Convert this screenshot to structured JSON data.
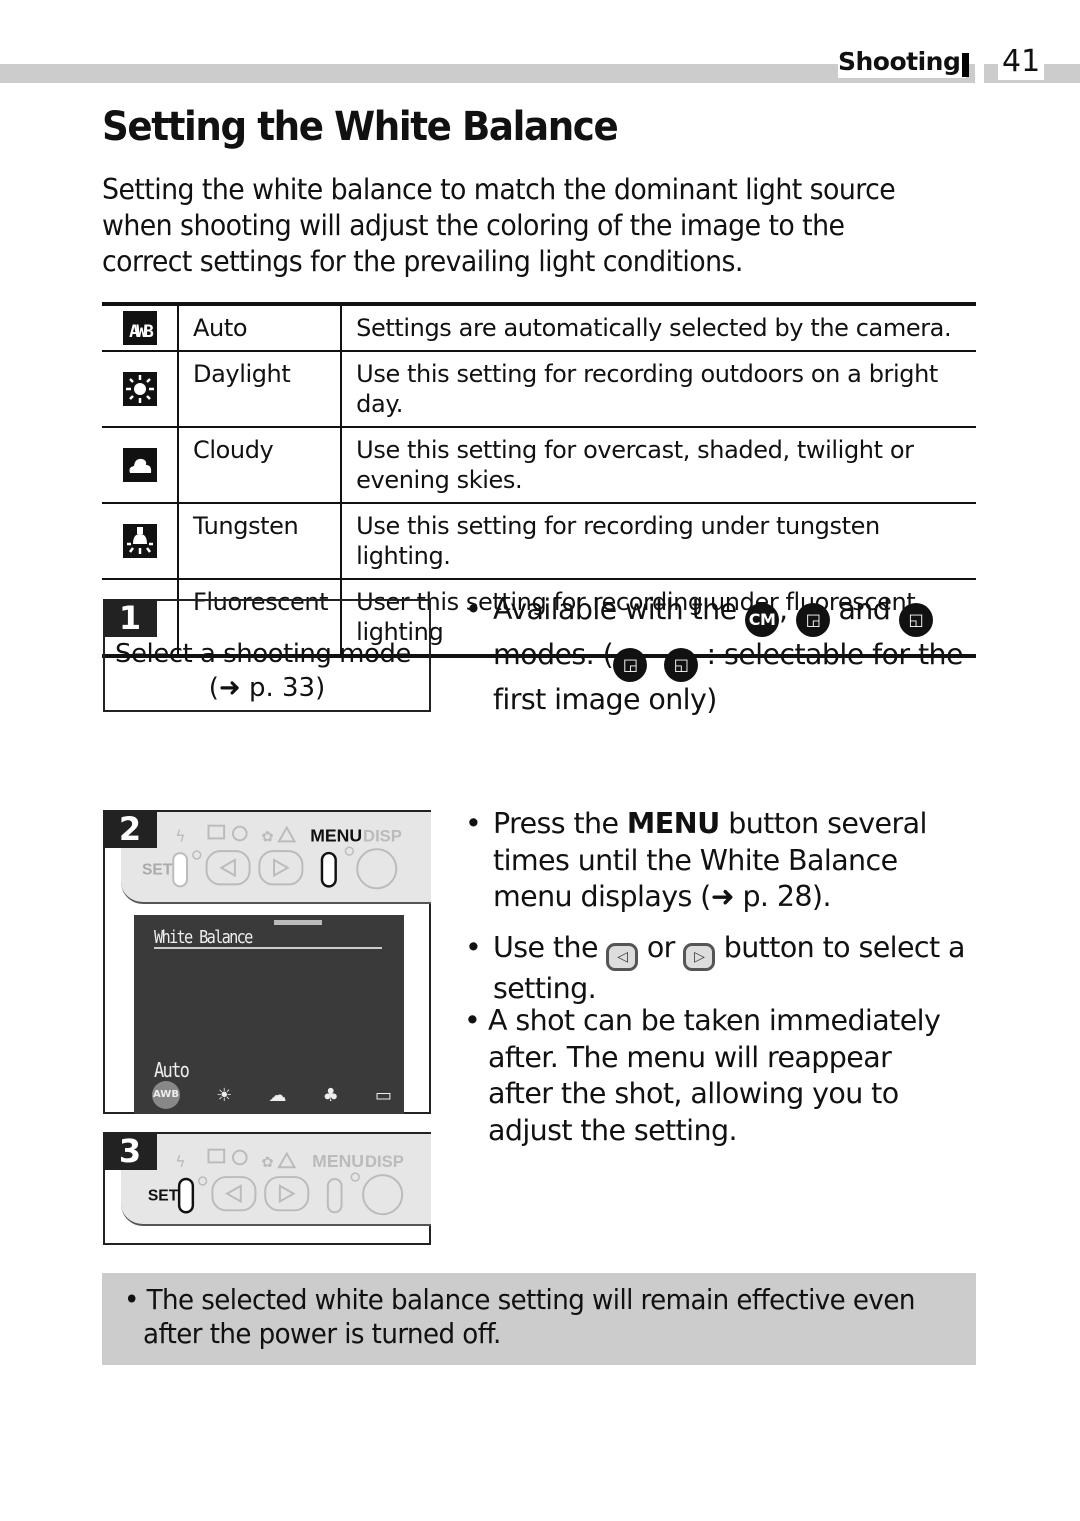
{
  "header": {
    "section": "Shooting",
    "page_number": "41"
  },
  "title": "Setting the White Balance",
  "intro": "Setting the white balance to match the dominant light source when shooting will adjust the coloring of the image to the correct settings for the prevailing light conditions.",
  "wb_table": {
    "rows": [
      {
        "icon": "awb-icon",
        "name": "Auto",
        "description": "Settings are automatically selected by the camera."
      },
      {
        "icon": "daylight-icon",
        "name": "Daylight",
        "description": "Use this setting for recording outdoors on a bright day."
      },
      {
        "icon": "cloudy-icon",
        "name": "Cloudy",
        "description": "Use this setting for overcast, shaded, twilight or evening skies."
      },
      {
        "icon": "tungsten-icon",
        "name": "Tungsten",
        "description": "Use this setting for recording under tungsten lighting."
      },
      {
        "icon": "fluorescent-icon",
        "name": "Fluorescent",
        "description": "User this setting for recording under fluorescent lighting"
      }
    ]
  },
  "step1": {
    "number": "1",
    "text": "Select a shooting mode",
    "ref": "(➜ p. 33)"
  },
  "step1_note": {
    "part1": "Available with the",
    "icon_cm": "CM",
    "comma": ",",
    "and": "and",
    "part2": "modes. (",
    "part3": ": selectable for the first image only)"
  },
  "step2": {
    "number": "2",
    "camera_labels": {
      "set": "SET",
      "menu": "MENU",
      "disp": "DISP"
    },
    "lcd": {
      "title": "White Balance",
      "selected": "Auto",
      "selected_icon": "AWB"
    }
  },
  "step3": {
    "number": "3",
    "camera_labels": {
      "set": "SET",
      "menu": "MENU",
      "disp": "DISP"
    }
  },
  "instructions": {
    "b1_pre": "Press the",
    "b1_menu": "MENU",
    "b1_post": "button several times until the White Balance menu displays (➜ p. 28).",
    "b2_pre": "Use the",
    "b2_or": "or",
    "b2_post": "button to select a setting.",
    "b3": "A shot can be taken immediately after. The menu will reappear after the shot, allowing you to adjust the setting."
  },
  "note": {
    "bullet": "•",
    "line1": "The selected white balance setting will remain effective even",
    "line2": "after the power is turned off."
  },
  "colors": {
    "header_bar": "#cccccc",
    "note_bg": "#cccccc",
    "lcd_bg": "#3a3a3a"
  }
}
